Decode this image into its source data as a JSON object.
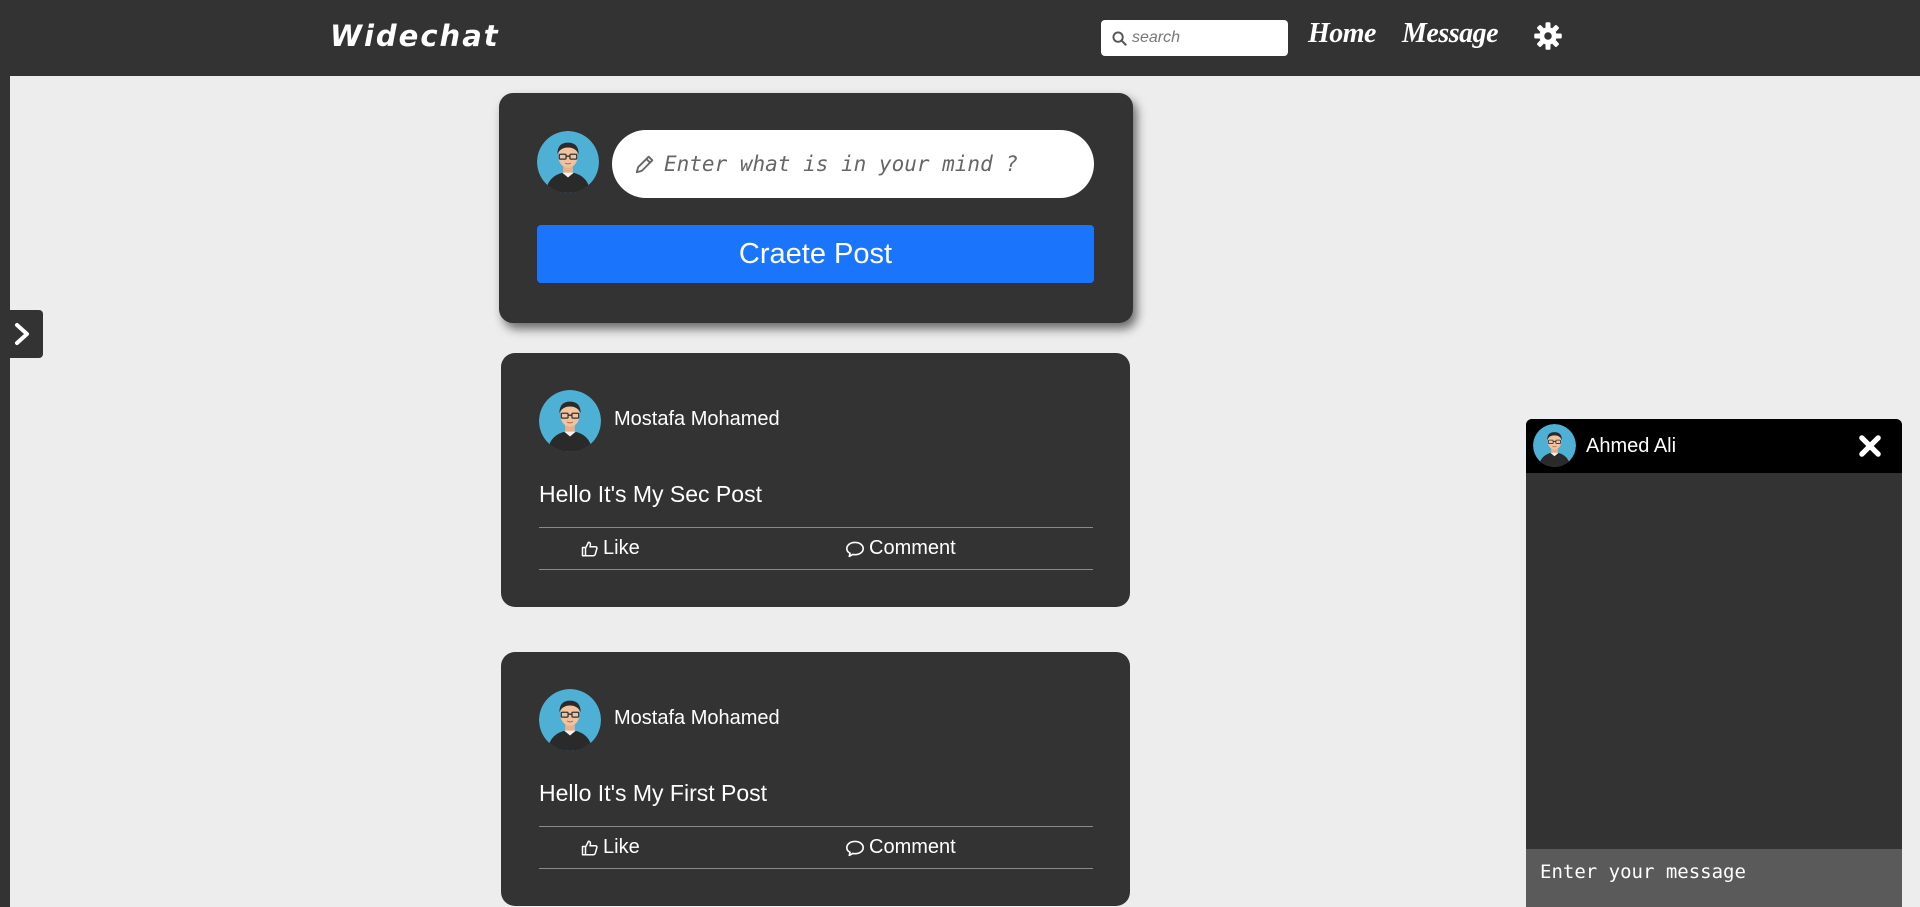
{
  "navbar": {
    "brand": "Widechat",
    "search_placeholder": "search",
    "links": {
      "home": "Home",
      "message": "Message"
    },
    "icons": [
      "search-icon",
      "gear-icon"
    ]
  },
  "composer": {
    "placeholder": "Enter what is in your mind ?",
    "button_label": "Craete Post",
    "icons": [
      "user-avatar",
      "pencil-icon"
    ]
  },
  "posts": [
    {
      "author": "Mostafa Mohamed",
      "text": "Hello It's My Sec Post",
      "like_label": "Like",
      "comment_label": "Comment"
    },
    {
      "author": "Mostafa Mohamed",
      "text": "Hello It's My First Post",
      "like_label": "Like",
      "comment_label": "Comment"
    }
  ],
  "chat": {
    "contact_name": "Ahmed Ali",
    "input_placeholder": "Enter your message",
    "icons": [
      "user-avatar",
      "close-icon"
    ]
  },
  "sidebar_toggle": {
    "icon": "chevron-right-icon"
  },
  "colors": {
    "navbar_bg": "#333333",
    "page_bg": "#ededed",
    "card_bg": "#333333",
    "primary_button": "#1b75fc",
    "chat_header_bg": "#000000",
    "chat_input_bg": "#5a5a5a",
    "avatar_bg": "#4fb0d6"
  }
}
